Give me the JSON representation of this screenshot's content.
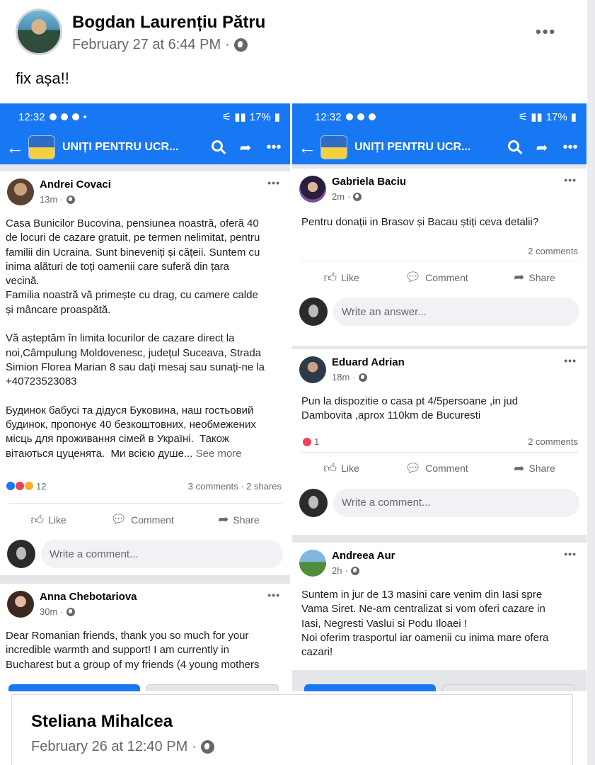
{
  "outer_post": {
    "author": "Bogdan Laurențiu Pătru",
    "date": "February 27 at 6:44 PM",
    "separator": "·",
    "more": "•••",
    "caption": "fix așa!!"
  },
  "left_screen": {
    "status_time": "12:32",
    "status_right": "17%",
    "group_title": "UNIȚI PENTRU UCR...",
    "posts": [
      {
        "author": "Andrei Covaci",
        "time": "13m",
        "text": "Casa Bunicilor Bucovina, pensiunea noastră, oferă 40\nde locuri de cazare gratuit, pe termen nelimitat, pentru\nfamilii din Ucraina. Sunt bineveniți și cățeii. Suntem cu\ninima alături de toți oamenii care suferă din țara\nvecină.\nFamilia noastră vă primește cu drag, cu camere calde\nși mâncare proaspătă.\n\nVă așteptăm în limita locurilor de cazare direct la\nnoi,Câmpulung Moldovenesc, județul Suceava, Strada\nSimion Florea Marian 8 sau dați mesaj sau sunați-ne la\n+40723523083\n\nБудинок бабусі та дідуся Буковина, наш гостьовий\nбудинок, пропонує 40 безкоштовних, необмежених\nмісць для проживання сімей в Україні.  Також\nвітаються цуценята.  Ми всією душе...",
        "see_more": "See more",
        "reaction_count": "12",
        "stats": "3 comments · 2 shares",
        "like": "Like",
        "comment": "Comment",
        "share": "Share",
        "composer_placeholder": "Write a comment..."
      },
      {
        "author": "Anna Chebotariova",
        "time": "30m",
        "text": "Dear Romanian friends, thank you so much for your\nincredible warmth and support! I am currently in\nBucharest but a group of my friends (4 young mothers"
      }
    ]
  },
  "right_screen": {
    "status_time": "12:32",
    "status_right": "17%",
    "group_title": "UNIȚI PENTRU UCR...",
    "posts": [
      {
        "author": "Gabriela Baciu",
        "time": "2m",
        "text": "Pentru donații in Brasov și Bacau știți ceva detalii?",
        "stats": "2 comments",
        "like": "Like",
        "comment": "Comment",
        "share": "Share",
        "composer_placeholder": "Write an answer..."
      },
      {
        "author": "Eduard Adrian",
        "time": "18m",
        "text": "Pun la dispozitie o casa pt 4/5persoane ,in jud\nDambovita ,aprox 110km de Bucuresti",
        "reaction_count": "1",
        "stats": "2 comments",
        "like": "Like",
        "comment": "Comment",
        "share": "Share",
        "composer_placeholder": "Write a comment..."
      },
      {
        "author": "Andreea Aur",
        "time": "2h",
        "text": "Suntem in jur de 13 masini care venim din Iasi spre\nVama Siret. Ne-am centralizat si vom oferi cazare in\nIasi, Negresti Vaslui si Podu Iloaei !\nNoi oferim trasportul iar oamenii cu inima mare ofera\ncazari!"
      }
    ]
  },
  "next_post": {
    "author": "Steliana Mihalcea",
    "date": "February 26 at 12:40 PM",
    "separator": "·"
  },
  "colors": {
    "facebook_blue": "#1877f2",
    "secondary_text": "#65676b",
    "love_red": "#f33e58"
  }
}
